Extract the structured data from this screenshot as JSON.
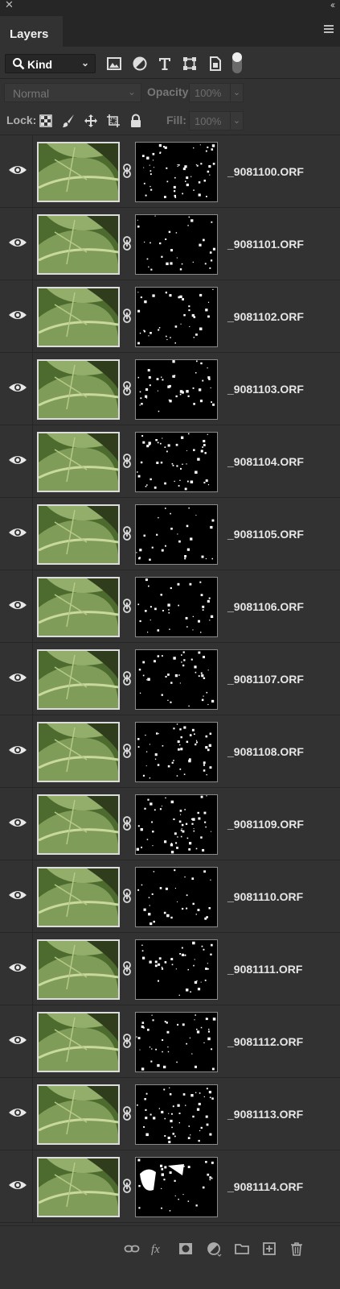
{
  "panel": {
    "title": "Layers"
  },
  "filter": {
    "kind_label": "Kind",
    "icons": [
      "pixel-filter-icon",
      "adjustment-filter-icon",
      "type-filter-icon",
      "shape-filter-icon",
      "smart-object-filter-icon",
      "filter-toggle-icon"
    ]
  },
  "blend": {
    "mode": "Normal",
    "opacity_label": "Opacity:",
    "opacity_value": "100%"
  },
  "lock": {
    "label": "Lock:",
    "fill_label": "Fill:",
    "fill_value": "100%",
    "icons": [
      "lock-transparent-pixels-icon",
      "lock-image-pixels-icon",
      "lock-position-icon",
      "prevent-autonest-icon",
      "lock-all-icon"
    ]
  },
  "layers": [
    {
      "name": "_9081100.ORF",
      "visible": true
    },
    {
      "name": "_9081101.ORF",
      "visible": true
    },
    {
      "name": "_9081102.ORF",
      "visible": true
    },
    {
      "name": "_9081103.ORF",
      "visible": true
    },
    {
      "name": "_9081104.ORF",
      "visible": true
    },
    {
      "name": "_9081105.ORF",
      "visible": true
    },
    {
      "name": "_9081106.ORF",
      "visible": true
    },
    {
      "name": "_9081107.ORF",
      "visible": true
    },
    {
      "name": "_9081108.ORF",
      "visible": true
    },
    {
      "name": "_9081109.ORF",
      "visible": true
    },
    {
      "name": "_9081110.ORF",
      "visible": true
    },
    {
      "name": "_9081111.ORF",
      "visible": true
    },
    {
      "name": "_9081112.ORF",
      "visible": true
    },
    {
      "name": "_9081113.ORF",
      "visible": true
    },
    {
      "name": "_9081114.ORF",
      "visible": true
    }
  ],
  "footer": {
    "icons": [
      "link-layers-icon",
      "fx-icon",
      "add-mask-icon",
      "adjustment-layer-icon",
      "new-group-icon",
      "new-layer-icon",
      "delete-layer-icon"
    ]
  },
  "colors": {
    "panel_bg": "#323232",
    "header_bg": "#262626",
    "text": "#e6e6e6"
  }
}
